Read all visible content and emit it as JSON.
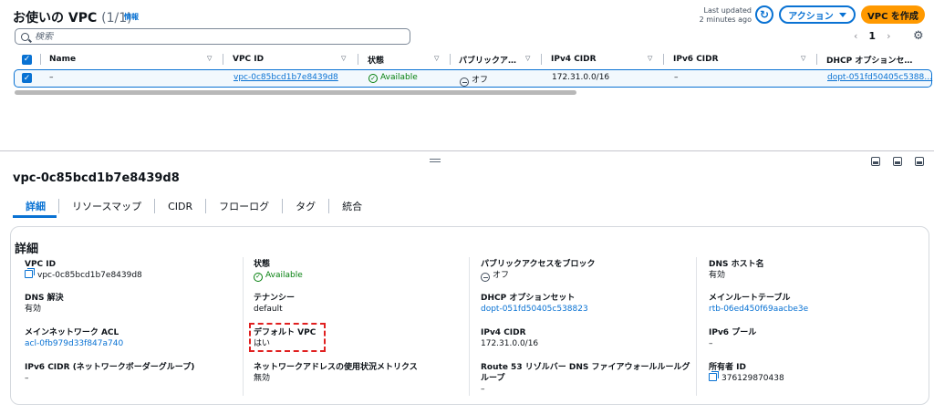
{
  "header": {
    "title": "お使いの VPC",
    "count": "(1/1)",
    "info_link": "情報",
    "last_updated_line1": "Last updated",
    "last_updated_line2": "2 minutes ago",
    "action_label": "アクション",
    "create_label": "VPC を作成"
  },
  "search": {
    "placeholder": "検索"
  },
  "pagination": {
    "prev": "‹",
    "current_page": "1",
    "next": "›"
  },
  "table": {
    "columns": [
      "Name",
      "VPC ID",
      "状態",
      "パブリックア…",
      "IPv4 CIDR",
      "IPv6 CIDR",
      "DHCP オプションセ…"
    ],
    "row": {
      "name": "–",
      "vpc_id": "vpc-0c85bcd1b7e8439d8",
      "state": "Available",
      "public_access": "オフ",
      "ipv4_cidr": "172.31.0.0/16",
      "ipv6_cidr": "–",
      "dhcp": "dopt-051fd50405c5388…"
    }
  },
  "detail": {
    "vpc_heading": "vpc-0c85bcd1b7e8439d8",
    "tabs": [
      "詳細",
      "リソースマップ",
      "CIDR",
      "フローログ",
      "タグ",
      "統合"
    ],
    "card_title": "詳細",
    "fields": {
      "vpc_id": {
        "label": "VPC ID",
        "value": "vpc-0c85bcd1b7e8439d8"
      },
      "dns_resolution": {
        "label": "DNS 解決",
        "value": "有効"
      },
      "main_nacl": {
        "label": "メインネットワーク ACL",
        "value": "acl-0fb979d33f847a740"
      },
      "ipv6_cidr_group": {
        "label": "IPv6 CIDR (ネットワークボーダーグループ)",
        "value": "–"
      },
      "state": {
        "label": "状態",
        "value": "Available"
      },
      "tenancy": {
        "label": "テナンシー",
        "value": "default"
      },
      "default_vpc": {
        "label": "デフォルト VPC",
        "value": "はい"
      },
      "net_usage_metrics": {
        "label": "ネットワークアドレスの使用状況メトリクス",
        "value": "無効"
      },
      "block_public_access": {
        "label": "パブリックアクセスをブロック",
        "value": "オフ"
      },
      "dhcp_option_set": {
        "label": "DHCP オプションセット",
        "value": "dopt-051fd50405c538823"
      },
      "ipv4_cidr": {
        "label": "IPv4 CIDR",
        "value": "172.31.0.0/16"
      },
      "route53_dns_fw_label_1": "Route 53 リゾルバー DNS ファイアウォールルールグ",
      "route53_dns_fw_label_2": "ループ",
      "route53_dns_fw_value": "–",
      "dns_hostnames": {
        "label": "DNS ホスト名",
        "value": "有効"
      },
      "main_route_table": {
        "label": "メインルートテーブル",
        "value": "rtb-06ed450f69aacbe3e"
      },
      "ipv6_pool": {
        "label": "IPv6 プール",
        "value": "–"
      },
      "owner_id": {
        "label": "所有者 ID",
        "value": "376129870438"
      }
    }
  },
  "icons": {
    "refresh": "refresh-icon",
    "settings": "gear-icon",
    "copy": "copy-icon",
    "status_ok": "check-circle-icon",
    "off": "minus-circle-icon"
  },
  "colors": {
    "accent": "#0972d3",
    "primary_button": "#ff9900",
    "success": "#037f0c",
    "highlight": "#e02020"
  }
}
